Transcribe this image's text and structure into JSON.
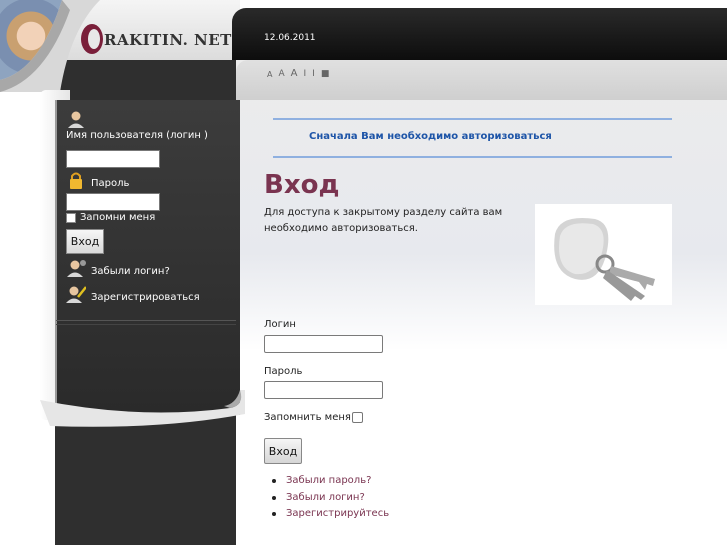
{
  "header": {
    "logo_text": "RAKITIN. NET",
    "date": "12.06.2011",
    "font_tools": [
      "A",
      "A",
      "A",
      "I",
      "I",
      "■"
    ]
  },
  "sidebar": {
    "username_label": "Имя пользователя (логин )",
    "password_label": "Пароль",
    "remember_label": "Запомни меня",
    "login_button": "Вход",
    "forgot_login": "Забыли логин?",
    "register": "Зарегистрироваться"
  },
  "main": {
    "notice": "Сначала Вам необходимо авторизоваться",
    "title": "Вход",
    "intro": "Для доступа к закрытому разделу сайта вам необходимо авторизоваться.",
    "login_label": "Логин",
    "password_label": "Пароль",
    "remember_label": "Запомнить меня",
    "submit_button": "Вход",
    "links": [
      "Забыли пароль?",
      "Забыли логин?",
      "Зарегистрируйтесь"
    ]
  },
  "colors": {
    "title": "#7a3450",
    "notice": "#1e55a8",
    "link": "#7a3450",
    "topbar": "#111111"
  }
}
